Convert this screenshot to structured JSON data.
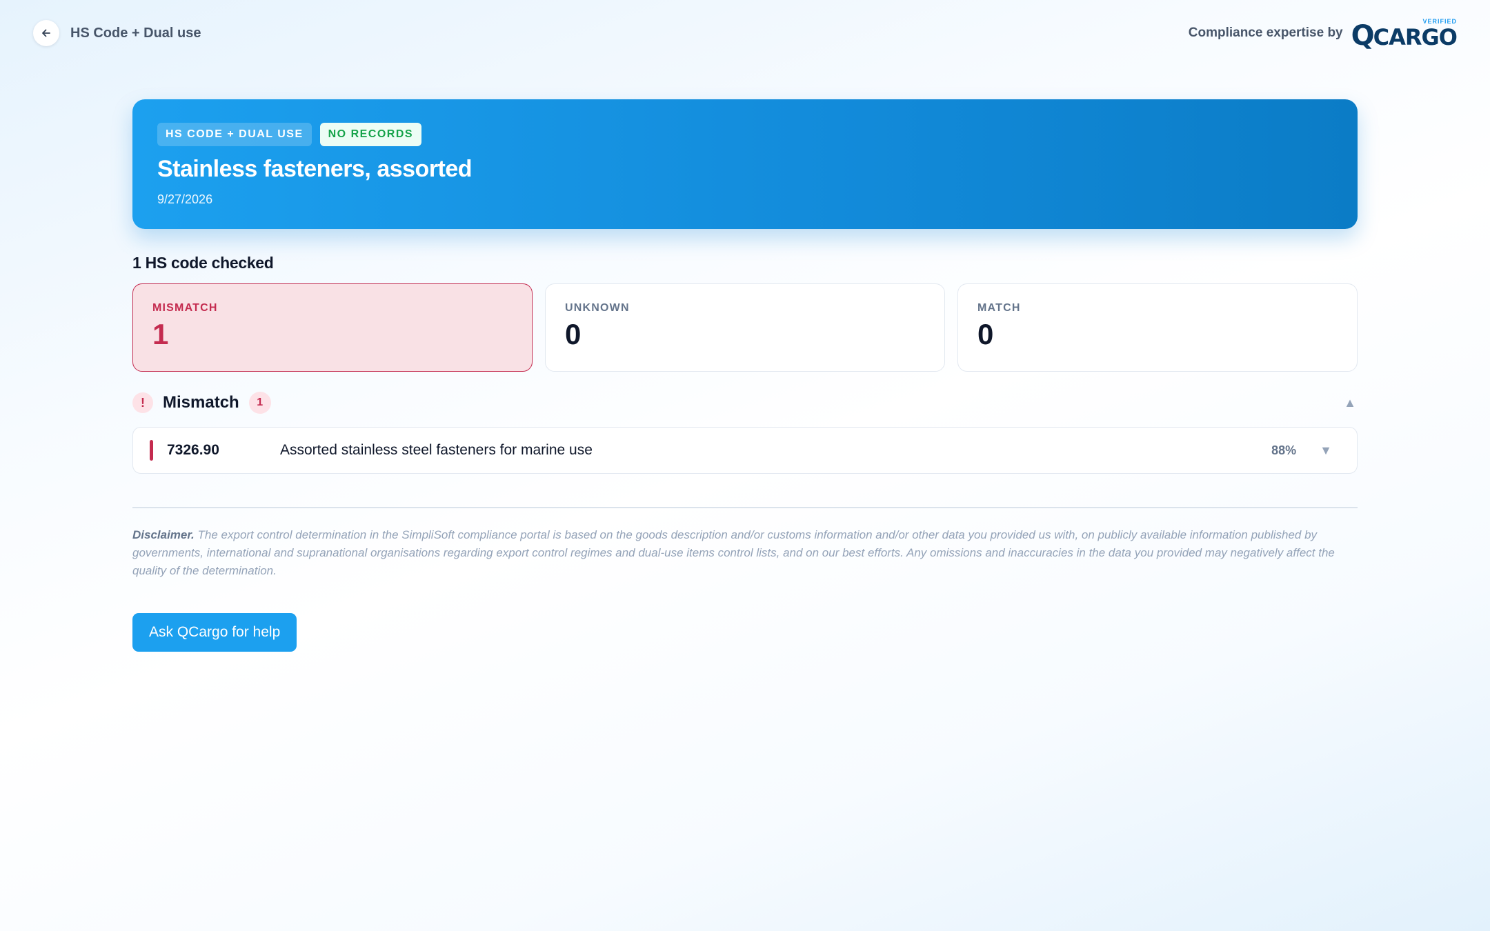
{
  "header": {
    "back_icon": "arrow-left-icon",
    "title": "HS Code + Dual use",
    "expertise_label": "Compliance expertise by",
    "logo": {
      "q": "Q",
      "cargo": "CARGO",
      "verified": "VERIFIED"
    }
  },
  "hero": {
    "type_badge": "HS CODE + DUAL USE",
    "status_badge": "NO RECORDS",
    "title": "Stainless fasteners, assorted",
    "date": "9/27/2026"
  },
  "summary": {
    "heading": "1 HS code checked",
    "stats": [
      {
        "label": "MISMATCH",
        "value": "1",
        "color": "#c42b4f"
      },
      {
        "label": "UNKNOWN",
        "value": "0"
      },
      {
        "label": "MATCH",
        "value": "0"
      }
    ]
  },
  "mismatch_section": {
    "alert_icon": "!",
    "title": "Mismatch",
    "count": "1",
    "collapse_icon": "▲",
    "items": [
      {
        "code": "7326.90",
        "description": "Assorted stainless steel fasteners for marine use",
        "score": "88%",
        "expand_icon": "▼"
      }
    ]
  },
  "disclaimer": {
    "label": "Disclaimer.",
    "text": "The export control determination in the SimpliSoft compliance portal is based on the goods description and/or customs information and/or other data you provided us with, on publicly available information published by governments, international and supranational organisations regarding export control regimes and dual-use items control lists, and on our best efforts. Any omissions and inaccuracies in the data you provided may negatively affect the quality of the determination."
  },
  "help_button": "Ask QCargo for help",
  "colors": {
    "accent": "#1ca0ef",
    "mismatch": "#c42b4f",
    "mismatch_bg": "#f9e1e5",
    "status_green": "#16a34a"
  }
}
